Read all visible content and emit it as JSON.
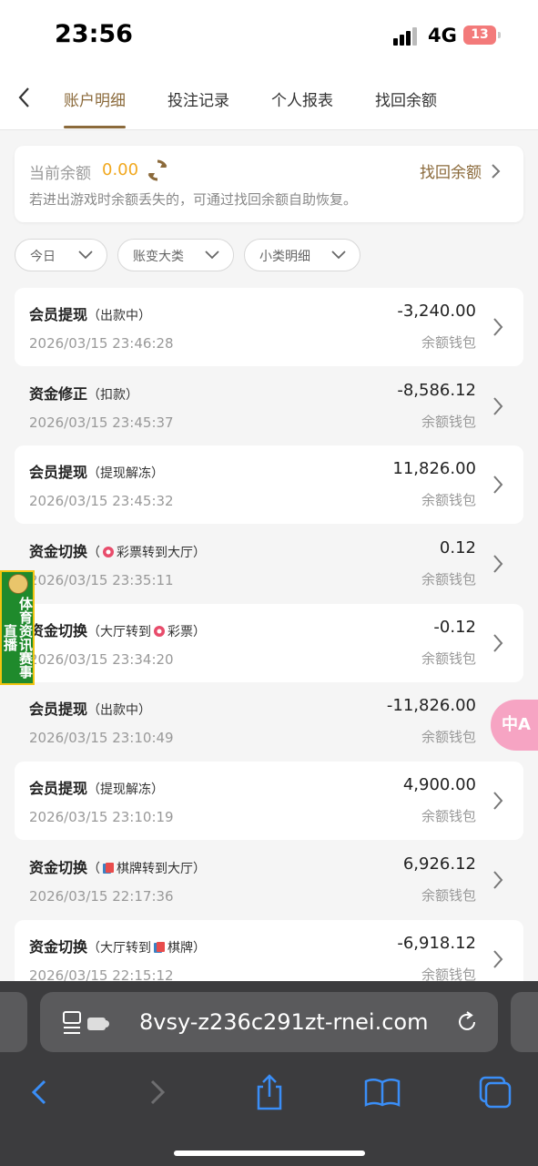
{
  "status_bar": {
    "time": "23:56",
    "network": "4G",
    "battery": "13"
  },
  "tabs": [
    {
      "label": "账户明细",
      "active": true
    },
    {
      "label": "投注记录",
      "active": false
    },
    {
      "label": "个人报表",
      "active": false
    },
    {
      "label": "找回余额",
      "active": false
    }
  ],
  "balance": {
    "label": "当前余额",
    "value": "0.00",
    "recover_label": "找回余额",
    "note": "若进出游戏时余额丢失的，可通过找回余额自助恢复。"
  },
  "filters": [
    {
      "label": "今日"
    },
    {
      "label": "账变大类"
    },
    {
      "label": "小类明细"
    }
  ],
  "transactions": [
    {
      "title": "会员提现",
      "pre": "（出款中）",
      "icon": "",
      "post": "",
      "date": "2026/03/15 23:46:28",
      "amount": "-3,240.00",
      "wallet": "余额钱包"
    },
    {
      "title": "资金修正",
      "pre": "（扣款）",
      "icon": "",
      "post": "",
      "date": "2026/03/15 23:45:37",
      "amount": "-8,586.12",
      "wallet": "余额钱包"
    },
    {
      "title": "会员提现",
      "pre": "（提现解冻）",
      "icon": "",
      "post": "",
      "date": "2026/03/15 23:45:32",
      "amount": "11,826.00",
      "wallet": "余额钱包"
    },
    {
      "title": "资金切换",
      "pre": "（",
      "icon": "lottery-icon",
      "post": "彩票转到大厅）",
      "date": "2026/03/15 23:35:11",
      "amount": "0.12",
      "wallet": "余额钱包"
    },
    {
      "title": "资金切换",
      "pre": "（大厅转到",
      "icon": "lottery-icon",
      "post": "彩票）",
      "date": "2026/03/15 23:34:20",
      "amount": "-0.12",
      "wallet": "余额钱包"
    },
    {
      "title": "会员提现",
      "pre": "（出款中）",
      "icon": "",
      "post": "",
      "date": "2026/03/15 23:10:49",
      "amount": "-11,826.00",
      "wallet": "余额钱包"
    },
    {
      "title": "会员提现",
      "pre": "（提现解冻）",
      "icon": "",
      "post": "",
      "date": "2026/03/15 23:10:19",
      "amount": "4,900.00",
      "wallet": "余额钱包"
    },
    {
      "title": "资金切换",
      "pre": "（",
      "icon": "cards-icon",
      "post": "棋牌转到大厅）",
      "date": "2026/03/15 22:17:36",
      "amount": "6,926.12",
      "wallet": "余额钱包"
    },
    {
      "title": "资金切换",
      "pre": "（大厅转到",
      "icon": "cards-icon",
      "post": "棋牌）",
      "date": "2026/03/15 22:15:12",
      "amount": "-6,918.12",
      "wallet": "余额钱包"
    }
  ],
  "ad_banner": {
    "text": "体育资讯赛事直播"
  },
  "translate_button": {
    "label": "中A"
  },
  "browser": {
    "url": "8vsy-z236c291zt-rnei.com"
  },
  "colors": {
    "accent": "#8b6a3b",
    "balance": "#f1a81f"
  }
}
